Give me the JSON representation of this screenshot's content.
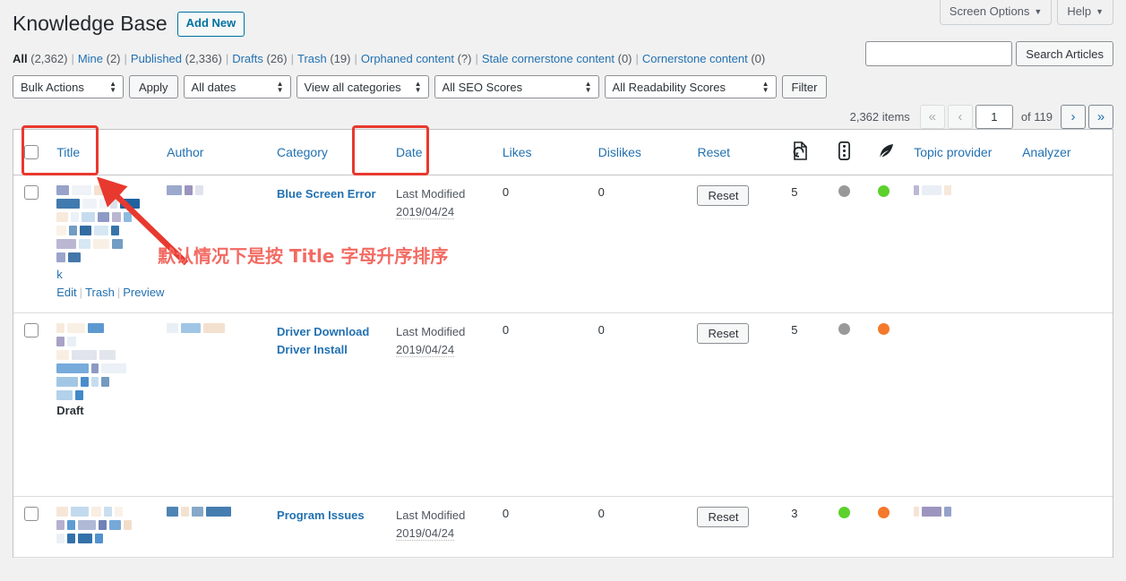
{
  "screen_meta": {
    "screen_options_label": "Screen Options",
    "help_label": "Help",
    "caret_icon": "chevron-down-icon"
  },
  "header": {
    "page_title": "Knowledge Base",
    "add_new_label": "Add New"
  },
  "views": [
    {
      "label": "All",
      "count": "(2,362)",
      "current": true
    },
    {
      "label": "Mine",
      "count": "(2)",
      "current": false
    },
    {
      "label": "Published",
      "count": "(2,336)",
      "current": false
    },
    {
      "label": "Drafts",
      "count": "(26)",
      "current": false
    },
    {
      "label": "Trash",
      "count": "(19)",
      "current": false
    },
    {
      "label": "Orphaned content",
      "count": "(?)",
      "current": false
    },
    {
      "label": "Stale cornerstone content",
      "count": "(0)",
      "current": false
    },
    {
      "label": "Cornerstone content",
      "count": "(0)",
      "current": false
    }
  ],
  "search": {
    "value": "",
    "placeholder": "",
    "button_label": "Search Articles"
  },
  "toolbar": {
    "bulk_actions": "Bulk Actions",
    "apply_label": "Apply",
    "all_dates": "All dates",
    "view_all_categories": "View all categories",
    "all_seo_scores": "All SEO Scores",
    "all_readability_scores": "All Readability Scores",
    "filter_label": "Filter"
  },
  "pagination": {
    "items_text": "2,362 items",
    "first_label": "«",
    "prev_label": "‹",
    "current_page": "1",
    "total_text": "of 119",
    "next_label": "›",
    "last_label": "»"
  },
  "table": {
    "columns": [
      {
        "label": "Title",
        "name": "title"
      },
      {
        "label": "Author",
        "name": "author"
      },
      {
        "label": "Category",
        "name": "category"
      },
      {
        "label": "Date",
        "name": "date"
      },
      {
        "label": "Likes",
        "name": "likes"
      },
      {
        "label": "Dislikes",
        "name": "dislikes"
      },
      {
        "label": "Reset",
        "name": "reset"
      },
      {
        "label": "",
        "name": "import-export-icon"
      },
      {
        "label": "",
        "name": "vertical-dots-icon"
      },
      {
        "label": "",
        "name": "feather-icon"
      },
      {
        "label": "Topic provider",
        "name": "topic-provider"
      },
      {
        "label": "Analyzer",
        "name": "analyzer"
      }
    ],
    "icons": {
      "col8": "document-import-icon",
      "col9": "vertical-dots-icon",
      "col10": "feather-pen-icon"
    },
    "rows": [
      {
        "title_redacted": true,
        "author_redacted": true,
        "categories": [
          "Blue Screen Error"
        ],
        "date_label": "Last Modified",
        "date_value": "2019/04/24",
        "likes": "0",
        "dislikes": "0",
        "reset_label": "Reset",
        "count": "5",
        "seo_dot": "#999999",
        "readability_dot": "#5cd12c",
        "topic_provider_redacted": true,
        "status": "",
        "row_actions": [
          "k Edit",
          "Trash",
          "Preview"
        ]
      },
      {
        "title_redacted": true,
        "author_redacted": true,
        "categories": [
          "Driver Download",
          "Driver Install"
        ],
        "date_label": "Last Modified",
        "date_value": "2019/04/24",
        "likes": "0",
        "dislikes": "0",
        "reset_label": "Reset",
        "count": "5",
        "seo_dot": "#999999",
        "readability_dot": "#f4792b",
        "topic_provider_redacted": false,
        "status": "Draft",
        "row_actions": []
      },
      {
        "title_redacted": true,
        "author_redacted": true,
        "categories": [
          "Program Issues"
        ],
        "date_label": "Last Modified",
        "date_value": "2019/04/24",
        "likes": "0",
        "dislikes": "0",
        "reset_label": "Reset",
        "count": "3",
        "seo_dot": "#5cd12c",
        "readability_dot": "#f4792b",
        "topic_provider_redacted": true,
        "status": "",
        "row_actions": []
      }
    ]
  },
  "annotations": {
    "note_text": "默认情况下是按 Title 字母升序排序",
    "highlight_color": "#e8392f",
    "note_color": "#f26b63",
    "boxed_columns": [
      "Title",
      "Date"
    ]
  }
}
